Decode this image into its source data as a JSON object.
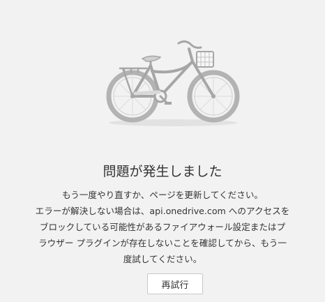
{
  "error": {
    "title": "問題が発生しました",
    "message_lines": [
      "もう一度やり直すか、ページを更新してください。",
      "エラーが解決しない場合は、api.onedrive.com へのアクセスを",
      "ブロックしている可能性があるファイアウォール設定またはプ",
      "ラウザー プラグインが存在しないことを確認してから、もう一",
      "度試してください。"
    ],
    "retry_label": "再試行"
  },
  "illustration": {
    "icon": "bicycle-icon",
    "colors": {
      "frame": "#a6a6a6",
      "wheel": "#b3b3b3",
      "shadow": "#e2e2e2",
      "accent": "#d9d9d9"
    }
  },
  "colors": {
    "background": "#f2f2f2",
    "text": "#333333",
    "button_border": "#c8c8c8",
    "button_bg": "#ffffff"
  }
}
